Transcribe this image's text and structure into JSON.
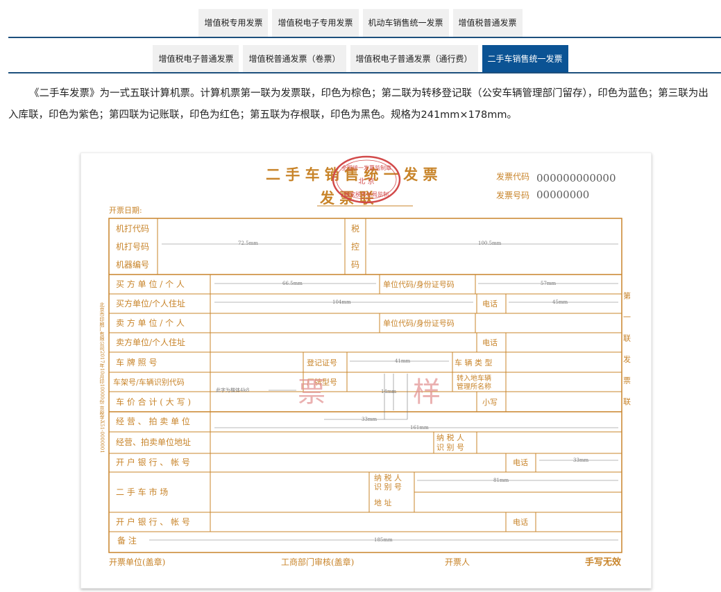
{
  "tabs_row1": [
    {
      "label": "增值税专用发票"
    },
    {
      "label": "增值税电子专用发票"
    },
    {
      "label": "机动车销售统一发票"
    },
    {
      "label": "增值税普通发票"
    }
  ],
  "tabs_row2": [
    {
      "label": "增值税电子普通发票"
    },
    {
      "label": "增值税普通发票（卷票）"
    },
    {
      "label": "增值税电子普通发票（通行费）"
    },
    {
      "label": "二手车销售统一发票"
    }
  ],
  "intro": "《二手车发票》为一式五联计算机票。计算机票第一联为发票联，印色为棕色；第二联为转移登记联（公安车辆管理部门留存），印色为蓝色；第三联为出入库联，印色为紫色；第四联为记账联，印色为红色；第五联为存根联，印色为黑色。规格为241mm×178mm。",
  "invoice": {
    "title": "二 手 车 销 售 统 一 发 票",
    "subtitle": "发 票 联",
    "code_label": "发票代码",
    "code_value": "000000000000",
    "number_label": "发票号码",
    "number_value": "00000000",
    "date_label": "开票日期:",
    "stamp_top": "全国统一发票监制章",
    "stamp_city": "北 京",
    "stamp_bottom": "国家税务总局监制",
    "row_machine_code": "机打代码",
    "row_machine_number": "机打号码",
    "row_machine_id": "机器编号",
    "tax_col_1": "税",
    "tax_col_2": "控",
    "tax_col_3": "码",
    "buyer": "买 方 单 位 / 个 人",
    "buyer_addr": "买方单位/个人住址",
    "seller": "卖 方 单 位 / 个 人",
    "seller_addr": "卖方单位/个人住址",
    "unit_id": "单位代码/身份证号码",
    "unit_id2": "单位代码/身份证号码",
    "phone": "电话",
    "phone2": "电话",
    "phone3": "电话",
    "phone4": "电话",
    "plate": "车 牌 照 号",
    "reg_no": "登记证号",
    "vehicle_type": "车 辆 类 型",
    "vin": "车架号/车辆识别代码",
    "brand_model": "厂牌型号",
    "transfer_office_1": "转入地车辆",
    "transfer_office_2": "管理所名称",
    "total_price": "车 价 合 计 ( 大 写 )",
    "small": "小写",
    "dealer": "经 营 、 拍 卖 单 位",
    "dealer_addr": "经营、拍卖单位地址",
    "taxpayer_id_1": "纳 税 人",
    "taxpayer_id_2": "识 别 号",
    "bank": "开 户 银 行 、 帐 号",
    "bank2": "开 户 银 行 、 帐 号",
    "market": "二 手 车 市 场",
    "market_tax_1": "纳 税 人",
    "market_tax_2": "识 别 号",
    "address": "地 址",
    "remarks": "备 注",
    "footer_issuer": "开票单位(盖章)",
    "footer_audit": "工商部门审核(盖章)",
    "footer_person": "开票人",
    "footer_handwrite": "手写无效",
    "side_copy": "第 一 联 发 票 联",
    "side_printer": "北京市印刷厂有限公司2017年10月印10000份 京税字X51-0000001",
    "sample_1": "票",
    "sample_2": "样",
    "font_note": "此字为楷体4k8",
    "dim_72": "72.5mm",
    "dim_100": "100.5mm",
    "dim_66": "66.5mm",
    "dim_57": "57mm",
    "dim_104": "104mm",
    "dim_45": "45mm",
    "dim_41": "41mm",
    "dim_14": "14mm",
    "dim_33": "33mm",
    "dim_161": "161mm",
    "dim_33b": "33mm",
    "dim_81": "81mm",
    "dim_185": "185mm"
  },
  "colors": {
    "brand": "#0b5394",
    "invoice": "#c8842a",
    "stamp": "#d24a4a"
  }
}
